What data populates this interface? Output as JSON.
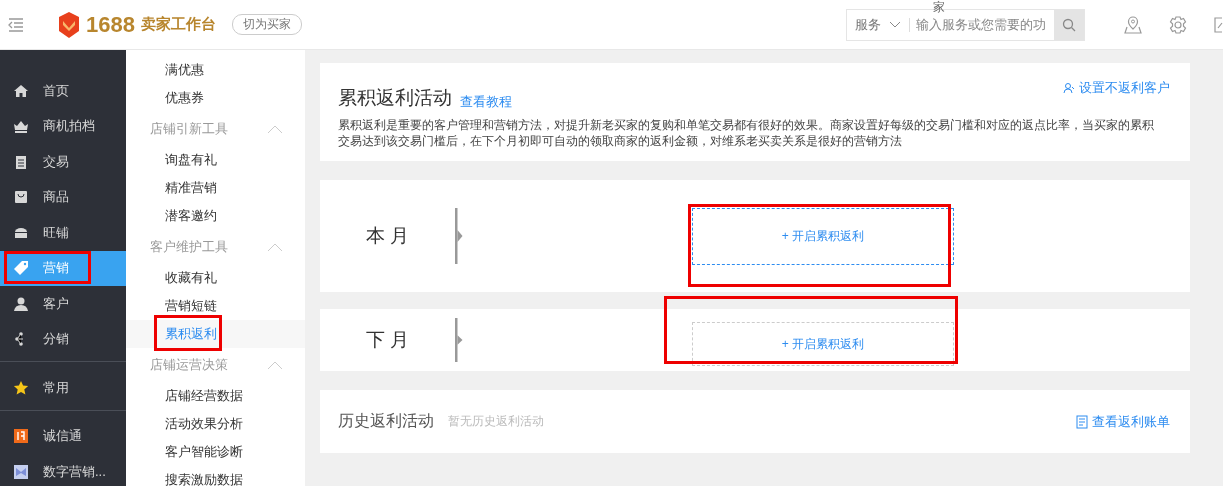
{
  "topbar": {
    "brand_number": "1688",
    "brand_title": "卖家工作台",
    "switch_button": "切为买家",
    "search_hint_above": "家",
    "search_scope": "服务",
    "search_placeholder": "输入服务或您需要的功"
  },
  "nav_sections": [
    {
      "items": [
        {
          "label": "首页",
          "selected": false,
          "highlighted": false
        },
        {
          "label": "商机拍档",
          "selected": false,
          "highlighted": false
        },
        {
          "label": "交易",
          "selected": false,
          "highlighted": false
        },
        {
          "label": "商品",
          "selected": false,
          "highlighted": false
        },
        {
          "label": "旺铺",
          "selected": false,
          "highlighted": false
        },
        {
          "label": "营销",
          "selected": true,
          "highlighted": true
        },
        {
          "label": "客户",
          "selected": false,
          "highlighted": false
        },
        {
          "label": "分销",
          "selected": false,
          "highlighted": false
        }
      ]
    },
    {
      "items": [
        {
          "label": "常用",
          "selected": false,
          "highlighted": false
        }
      ]
    },
    {
      "items": [
        {
          "label": "诚信通",
          "selected": false,
          "highlighted": false
        },
        {
          "label": "数字营销...",
          "selected": false,
          "highlighted": false
        }
      ]
    }
  ],
  "submenu": [
    {
      "kind": "item",
      "label": "满优惠",
      "selected": false,
      "highlighted": false
    },
    {
      "kind": "item",
      "label": "优惠券",
      "selected": false,
      "highlighted": false
    },
    {
      "kind": "group",
      "label": "店铺引新工具",
      "expanded": true
    },
    {
      "kind": "item",
      "label": "询盘有礼",
      "selected": false,
      "highlighted": false
    },
    {
      "kind": "item",
      "label": "精准营销",
      "selected": false,
      "highlighted": false
    },
    {
      "kind": "item",
      "label": "潜客邀约",
      "selected": false,
      "highlighted": false
    },
    {
      "kind": "group",
      "label": "客户维护工具",
      "expanded": true
    },
    {
      "kind": "item",
      "label": "收藏有礼",
      "selected": false,
      "highlighted": false
    },
    {
      "kind": "item",
      "label": "营销短链",
      "selected": false,
      "highlighted": false
    },
    {
      "kind": "item",
      "label": "累积返利",
      "selected": true,
      "highlighted": true
    },
    {
      "kind": "group",
      "label": "店铺运营决策",
      "expanded": true
    },
    {
      "kind": "item",
      "label": "店铺经营数据",
      "selected": false,
      "highlighted": false
    },
    {
      "kind": "item",
      "label": "活动效果分析",
      "selected": false,
      "highlighted": false
    },
    {
      "kind": "item",
      "label": "客户智能诊断",
      "selected": false,
      "highlighted": false
    },
    {
      "kind": "item",
      "label": "搜索激励数据",
      "selected": false,
      "highlighted": false
    }
  ],
  "intro": {
    "title": "累积返利活动",
    "tutorial_link": "查看教程",
    "exclude_link": "设置不返利客户",
    "description": "累积返利是重要的客户管理和营销方法，对提升新老买家的复购和单笔交易都有很好的效果。商家设置好每级的交易门槛和对应的返点比率，当买家的累积交易达到该交易门槛后，在下个月初即可自动的领取商家的返利金额，对维系老买卖关系是很好的营销方法"
  },
  "months": [
    {
      "label": "本 月",
      "action": "+ 开启累积返利",
      "active": true,
      "highlighted": true
    },
    {
      "label": "下 月",
      "action": "+ 开启累积返利",
      "active": false,
      "highlighted": true
    }
  ],
  "history": {
    "title": "历史返利活动",
    "empty_note": "暂无历史返利活动",
    "ledger_link": "查看返利账单"
  }
}
